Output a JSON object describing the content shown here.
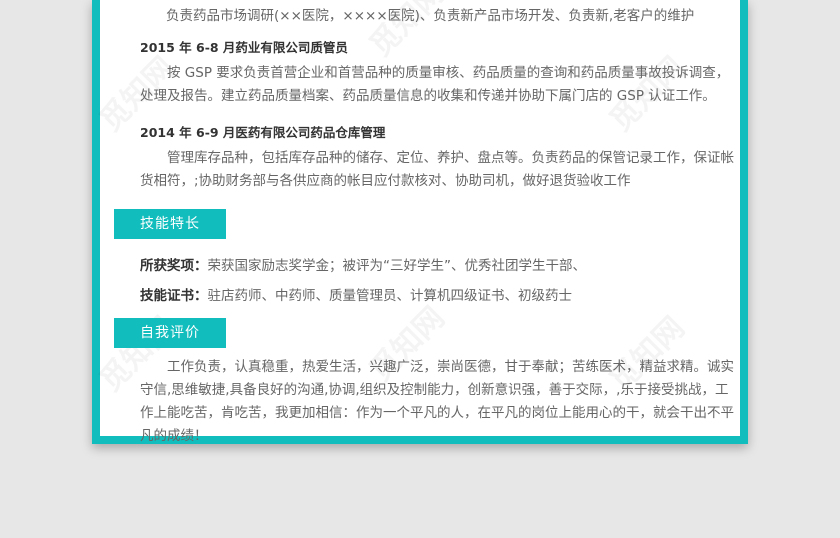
{
  "top_line": "负责药品市场调研(××医院，××××医院)、负责新产品市场开发、负责新,老客户的维护",
  "jobs": [
    {
      "title": "2015 年 6-8 月药业有限公司质管员",
      "desc": "按 GSP 要求负责首营企业和首营品种的质量审核、药品质量的查询和药品质量事故投诉调查，处理及报告。建立药品质量档案、药品质量信息的收集和传递并协助下属门店的 GSP 认证工作。"
    },
    {
      "title": "2014 年 6-9 月医药有限公司药品仓库管理",
      "desc": "管理库存品种，包括库存品种的储存、定位、养护、盘点等。负责药品的保管记录工作，保证帐货相符，;协助财务部与各供应商的帐目应付款核对、协助司机，做好退货验收工作"
    }
  ],
  "skills": {
    "heading": "技能特长",
    "awards_label": "所获奖项：",
    "awards_value": "荣获国家励志奖学金；被评为“三好学生”、优秀社团学生干部、",
    "certs_label": "技能证书：",
    "certs_value": "驻店药师、中药师、质量管理员、计算机四级证书、初级药士"
  },
  "self_eval": {
    "heading": "自我评价",
    "text": "工作负责，认真稳重，热爱生活，兴趣广泛，崇尚医德，甘于奉献；苦练医术，精益求精。诚实守信,思维敏捷,具备良好的沟通,协调,组织及控制能力，创新意识强，善于交际，,乐于接受挑战，工作上能吃苦，肯吃苦，我更加相信：作为一个平凡的人，在平凡的岗位上能用心的干，就会干出不平凡的成绩！"
  },
  "watermark": "觅知网"
}
